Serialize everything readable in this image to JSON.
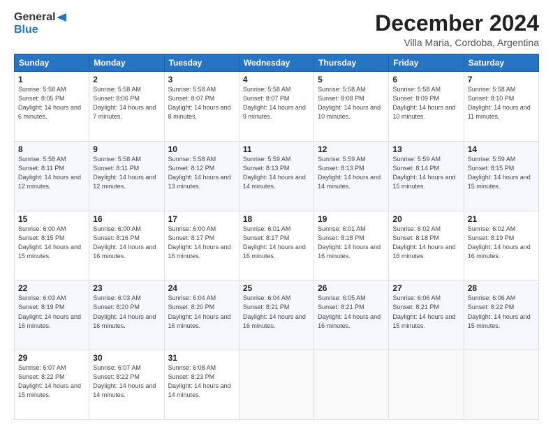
{
  "header": {
    "logo_general": "General",
    "logo_blue": "Blue",
    "month_title": "December 2024",
    "location": "Villa Maria, Cordoba, Argentina"
  },
  "calendar": {
    "days_of_week": [
      "Sunday",
      "Monday",
      "Tuesday",
      "Wednesday",
      "Thursday",
      "Friday",
      "Saturday"
    ],
    "weeks": [
      [
        null,
        null,
        null,
        null,
        {
          "day": "5",
          "sunrise": "5:58 AM",
          "sunset": "8:08 PM",
          "daylight": "14 hours and 10 minutes."
        },
        {
          "day": "6",
          "sunrise": "5:58 AM",
          "sunset": "8:09 PM",
          "daylight": "14 hours and 10 minutes."
        },
        {
          "day": "7",
          "sunrise": "5:58 AM",
          "sunset": "8:10 PM",
          "daylight": "14 hours and 11 minutes."
        }
      ],
      [
        {
          "day": "1",
          "sunrise": "5:58 AM",
          "sunset": "8:05 PM",
          "daylight": "14 hours and 6 minutes."
        },
        {
          "day": "2",
          "sunrise": "5:58 AM",
          "sunset": "8:06 PM",
          "daylight": "14 hours and 7 minutes."
        },
        {
          "day": "3",
          "sunrise": "5:58 AM",
          "sunset": "8:07 PM",
          "daylight": "14 hours and 8 minutes."
        },
        {
          "day": "4",
          "sunrise": "5:58 AM",
          "sunset": "8:07 PM",
          "daylight": "14 hours and 9 minutes."
        },
        {
          "day": "5",
          "sunrise": "5:58 AM",
          "sunset": "8:08 PM",
          "daylight": "14 hours and 10 minutes."
        },
        {
          "day": "6",
          "sunrise": "5:58 AM",
          "sunset": "8:09 PM",
          "daylight": "14 hours and 10 minutes."
        },
        {
          "day": "7",
          "sunrise": "5:58 AM",
          "sunset": "8:10 PM",
          "daylight": "14 hours and 11 minutes."
        }
      ],
      [
        {
          "day": "8",
          "sunrise": "5:58 AM",
          "sunset": "8:11 PM",
          "daylight": "14 hours and 12 minutes."
        },
        {
          "day": "9",
          "sunrise": "5:58 AM",
          "sunset": "8:11 PM",
          "daylight": "14 hours and 12 minutes."
        },
        {
          "day": "10",
          "sunrise": "5:58 AM",
          "sunset": "8:12 PM",
          "daylight": "14 hours and 13 minutes."
        },
        {
          "day": "11",
          "sunrise": "5:59 AM",
          "sunset": "8:13 PM",
          "daylight": "14 hours and 14 minutes."
        },
        {
          "day": "12",
          "sunrise": "5:59 AM",
          "sunset": "8:13 PM",
          "daylight": "14 hours and 14 minutes."
        },
        {
          "day": "13",
          "sunrise": "5:59 AM",
          "sunset": "8:14 PM",
          "daylight": "14 hours and 15 minutes."
        },
        {
          "day": "14",
          "sunrise": "5:59 AM",
          "sunset": "8:15 PM",
          "daylight": "14 hours and 15 minutes."
        }
      ],
      [
        {
          "day": "15",
          "sunrise": "6:00 AM",
          "sunset": "8:15 PM",
          "daylight": "14 hours and 15 minutes."
        },
        {
          "day": "16",
          "sunrise": "6:00 AM",
          "sunset": "8:16 PM",
          "daylight": "14 hours and 16 minutes."
        },
        {
          "day": "17",
          "sunrise": "6:00 AM",
          "sunset": "8:17 PM",
          "daylight": "14 hours and 16 minutes."
        },
        {
          "day": "18",
          "sunrise": "6:01 AM",
          "sunset": "8:17 PM",
          "daylight": "14 hours and 16 minutes."
        },
        {
          "day": "19",
          "sunrise": "6:01 AM",
          "sunset": "8:18 PM",
          "daylight": "14 hours and 16 minutes."
        },
        {
          "day": "20",
          "sunrise": "6:02 AM",
          "sunset": "8:18 PM",
          "daylight": "14 hours and 16 minutes."
        },
        {
          "day": "21",
          "sunrise": "6:02 AM",
          "sunset": "8:19 PM",
          "daylight": "14 hours and 16 minutes."
        }
      ],
      [
        {
          "day": "22",
          "sunrise": "6:03 AM",
          "sunset": "8:19 PM",
          "daylight": "14 hours and 16 minutes."
        },
        {
          "day": "23",
          "sunrise": "6:03 AM",
          "sunset": "8:20 PM",
          "daylight": "14 hours and 16 minutes."
        },
        {
          "day": "24",
          "sunrise": "6:04 AM",
          "sunset": "8:20 PM",
          "daylight": "14 hours and 16 minutes."
        },
        {
          "day": "25",
          "sunrise": "6:04 AM",
          "sunset": "8:21 PM",
          "daylight": "14 hours and 16 minutes."
        },
        {
          "day": "26",
          "sunrise": "6:05 AM",
          "sunset": "8:21 PM",
          "daylight": "14 hours and 16 minutes."
        },
        {
          "day": "27",
          "sunrise": "6:06 AM",
          "sunset": "8:21 PM",
          "daylight": "14 hours and 15 minutes."
        },
        {
          "day": "28",
          "sunrise": "6:06 AM",
          "sunset": "8:22 PM",
          "daylight": "14 hours and 15 minutes."
        }
      ],
      [
        {
          "day": "29",
          "sunrise": "6:07 AM",
          "sunset": "8:22 PM",
          "daylight": "14 hours and 15 minutes."
        },
        {
          "day": "30",
          "sunrise": "6:07 AM",
          "sunset": "8:22 PM",
          "daylight": "14 hours and 14 minutes."
        },
        {
          "day": "31",
          "sunrise": "6:08 AM",
          "sunset": "8:23 PM",
          "daylight": "14 hours and 14 minutes."
        },
        null,
        null,
        null,
        null
      ]
    ]
  }
}
